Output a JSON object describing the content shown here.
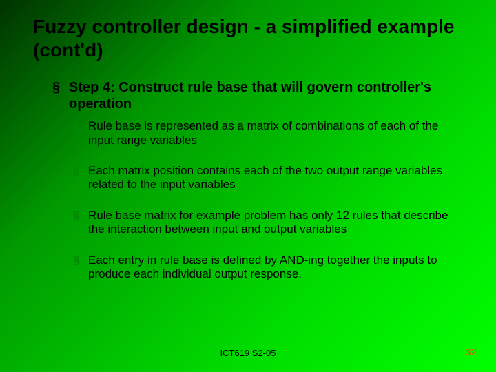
{
  "title": "Fuzzy controller design - a simplified example (cont'd)",
  "step": "Step 4: Construct rule base that will govern controller's operation",
  "bullets": [
    "Rule base is represented as a matrix of combinations of each of the input range variables",
    "Each matrix position contains each of the two output range variables related to the input variables",
    "Rule base matrix for example problem has only 12 rules that describe the interaction between input and output variables",
    "Each entry in rule base is defined by AND-ing together the inputs to produce each individual output response."
  ],
  "footer_center": "ICT619 S2-05",
  "footer_right": "32"
}
